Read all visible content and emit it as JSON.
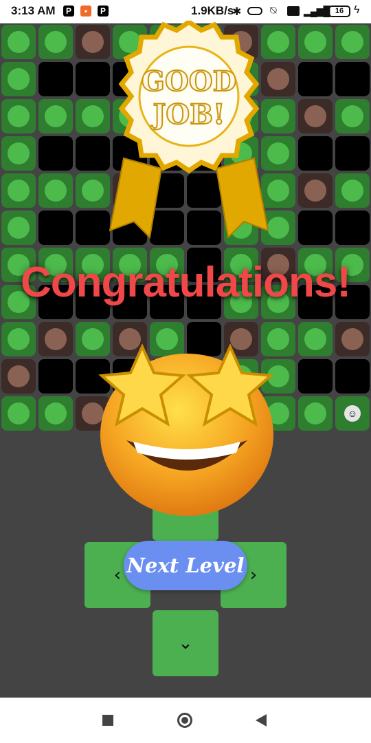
{
  "status_bar": {
    "time": "3:13 AM",
    "network_speed": "1.9KB/s",
    "battery": "16",
    "icons": [
      "p-icon",
      "app-icon",
      "p-icon",
      "bluetooth-icon",
      "toggle-icon",
      "mute-icon",
      "volte-icon",
      "signal-icon",
      "battery-icon",
      "charging-icon"
    ]
  },
  "board": {
    "legend": {
      "G": "grass",
      "D": "dirt",
      "H": "hole",
      "P": "player"
    },
    "rows": [
      "GGDGGGDGGG",
      "GHHHHHGDHH",
      "GGGGHHGGDG",
      "GHHHHHGGHH",
      "GGGDHHGGDG",
      "GHHHHHGGHH",
      "GGGGGHGDGG",
      "GHHHHHGGHH",
      "GDGDGHDGGD",
      "DHHHHHGGHH",
      "GGDGGGGGGP"
    ],
    "colors": {
      "grass_bg": "#2f7d2f",
      "grass_dot": "#4cbb4c",
      "dirt_bg": "#3d2b28",
      "dirt_dot": "#8a6254",
      "hole": "#000000"
    }
  },
  "overlay": {
    "badge_text": [
      "GOOD",
      "JOB!"
    ],
    "title": "Congratulations!",
    "title_color": "#f04848",
    "emoji": "star-struck"
  },
  "controls": {
    "up": "^",
    "left": "‹",
    "right": "›",
    "down": "⌄",
    "next_level_label": "Next Level",
    "next_level_color": "#6a8ff0",
    "pad_color": "#4caf50"
  },
  "nav_bar": {
    "items": [
      "recents-square",
      "home-circle",
      "back-triangle"
    ]
  }
}
